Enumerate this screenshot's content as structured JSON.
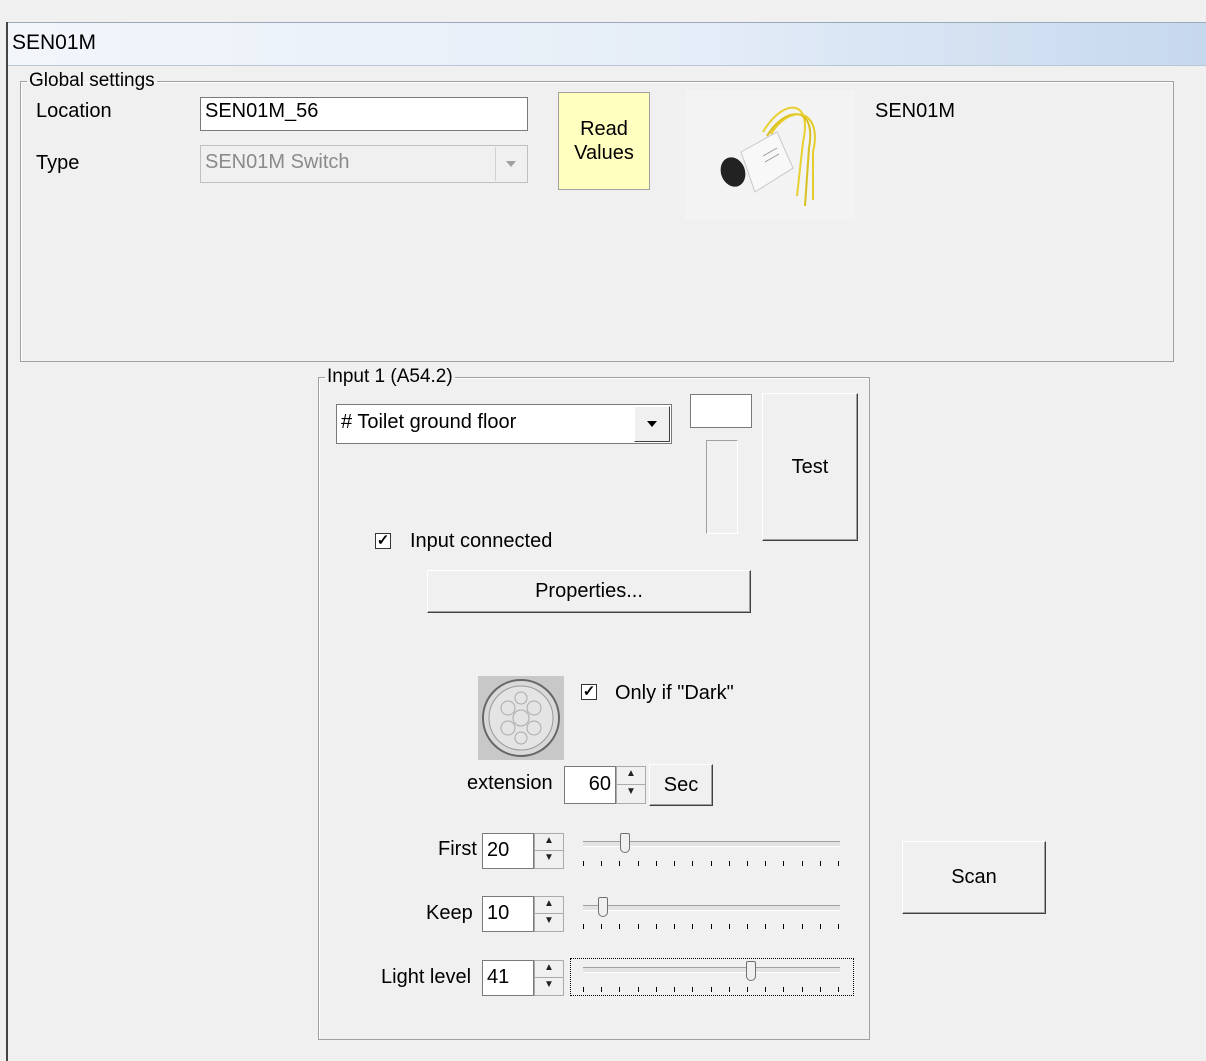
{
  "window": {
    "title": "SEN01M"
  },
  "global": {
    "legend": "Global settings",
    "location_label": "Location",
    "location_value": "SEN01M_56",
    "type_label": "Type",
    "type_value": "SEN01M Switch",
    "read_values_label": "Read\nValues",
    "device_name": "SEN01M",
    "device_image": "sensor-device-photo"
  },
  "input1": {
    "legend": "Input 1 (A54.2)",
    "name_value": "# Toilet ground floor",
    "test_label": "Test",
    "connected_label": "Input connected",
    "connected_checked": true,
    "properties_label": "Properties...",
    "pir_image": "pir-lens-icon",
    "only_dark_label": "Only if \"Dark\"",
    "only_dark_checked": true,
    "extension_label": "extension",
    "extension_value": "60",
    "sec_label": "Sec",
    "first_label": "First",
    "first_value": "20",
    "keep_label": "Keep",
    "keep_value": "10",
    "light_label": "Light level",
    "light_value": "41"
  },
  "scan_label": "Scan",
  "colors": {
    "read_values_bg": "#ffffc0",
    "title_gradient_end": "#c6d8ee"
  }
}
